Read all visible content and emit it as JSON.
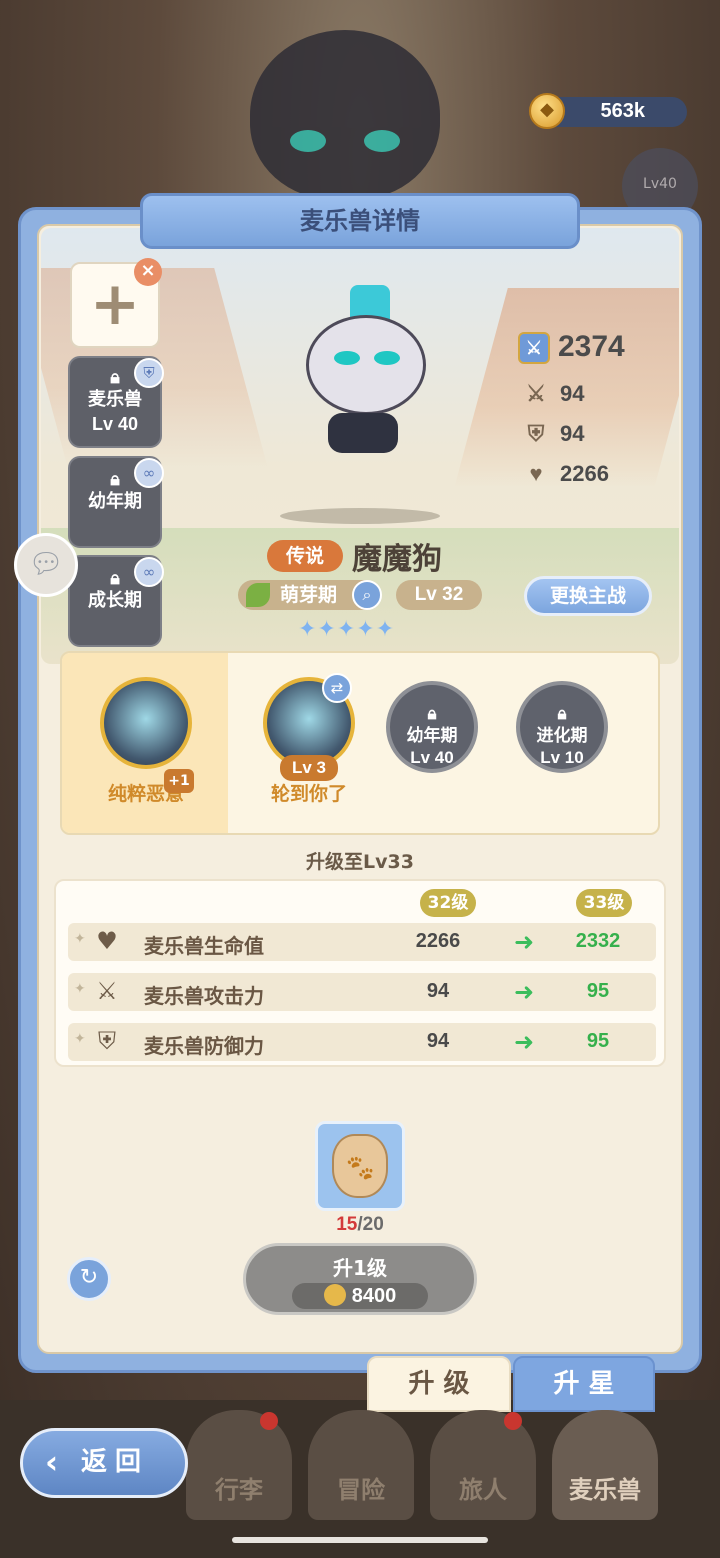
{
  "header": {
    "coins": "563k",
    "lock_badge": "Lv40"
  },
  "panel": {
    "title": "麦乐兽详情"
  },
  "slots": [
    {
      "line1": "麦乐兽",
      "line2": "Lv 40",
      "badge": "shield"
    },
    {
      "line1": "幼年期",
      "line2": "",
      "badge": "link"
    },
    {
      "line1": "成长期",
      "line2": "",
      "badge": "link"
    }
  ],
  "pet": {
    "rarity": "传说",
    "name": "魔魔狗",
    "stage": "萌芽期",
    "level": "Lv 32",
    "swap_label": "更换主战",
    "stars": "✦✦✦✦✦"
  },
  "stats": {
    "power": "2374",
    "attack": "94",
    "defense": "94",
    "hp": "2266"
  },
  "skills": [
    {
      "label": "纯粹恶意",
      "badge": "+1",
      "state": "selected"
    },
    {
      "label": "轮到你了",
      "badge": "Lv 3",
      "state": "active"
    },
    {
      "label": "",
      "line1": "幼年期",
      "line2": "Lv 40",
      "state": "locked"
    },
    {
      "label": "",
      "line1": "进化期",
      "line2": "Lv 10",
      "state": "locked"
    }
  ],
  "upgrade": {
    "title": "升级至Lv33",
    "from_tag": "32级",
    "to_tag": "33级",
    "rows": [
      {
        "name": "麦乐兽生命值",
        "from": "2266",
        "to": "2332",
        "icon": "heart-icon"
      },
      {
        "name": "麦乐兽攻击力",
        "from": "94",
        "to": "95",
        "icon": "swords-icon"
      },
      {
        "name": "麦乐兽防御力",
        "from": "94",
        "to": "95",
        "icon": "shield-icon"
      }
    ]
  },
  "item": {
    "have": "15",
    "need": "/20"
  },
  "action": {
    "label": "升1级",
    "cost": "8400"
  },
  "tabs": {
    "upgrade": "升 级",
    "star": "升 星"
  },
  "nav": {
    "back": "返回",
    "bag": "行李",
    "adventure": "冒险",
    "traveler": "旅人",
    "pets": "麦乐兽"
  },
  "colors": {
    "panel_blue": "#8fb1e0",
    "gain_green": "#36b04c",
    "rarity_orange": "#d9783b"
  }
}
